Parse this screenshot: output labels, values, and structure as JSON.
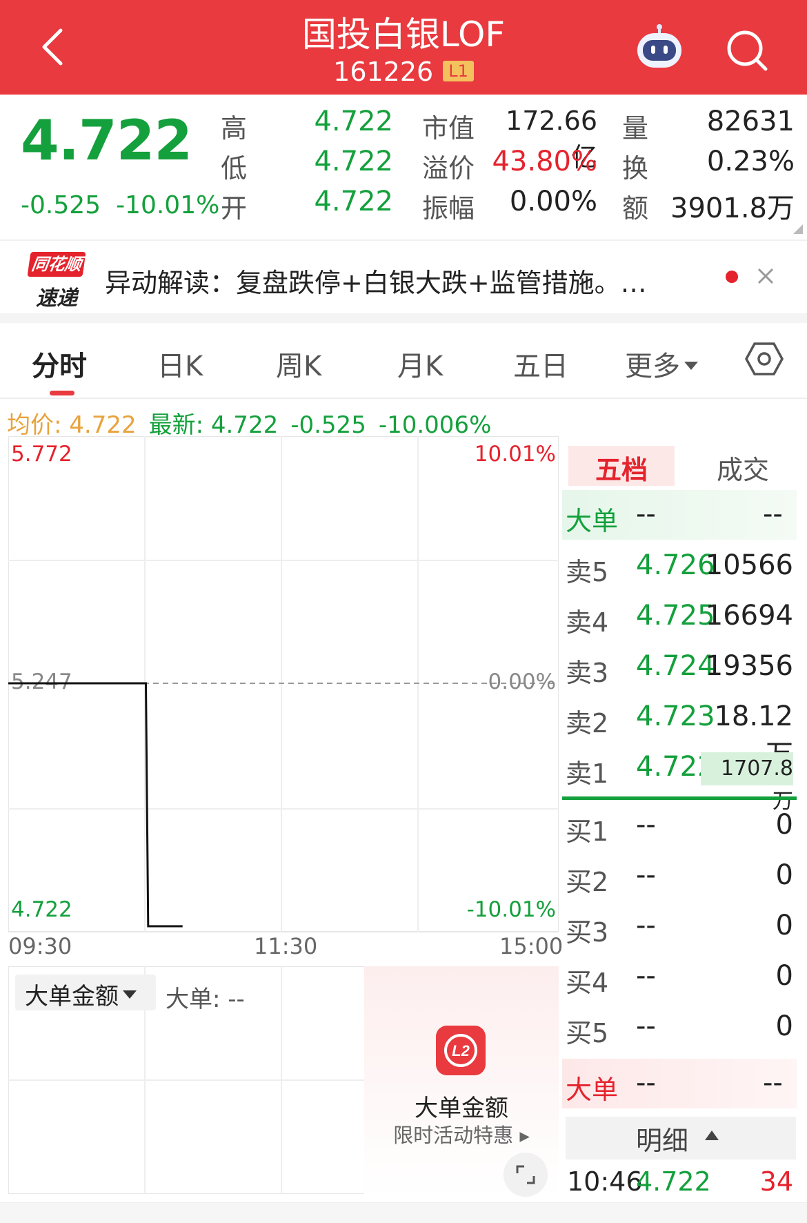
{
  "header": {
    "title": "国投白银LOF",
    "code": "161226",
    "level_badge": "L1"
  },
  "quote": {
    "price": "4.722",
    "change": "-0.525",
    "change_pct": "-10.01%",
    "fields": [
      {
        "label": "高",
        "value": "4.722"
      },
      {
        "label": "低",
        "value": "4.722"
      },
      {
        "label": "开",
        "value": "4.722"
      },
      {
        "label": "市值",
        "value": "172.66亿"
      },
      {
        "label": "溢价",
        "value": "43.80%"
      },
      {
        "label": "振幅",
        "value": "0.00%"
      },
      {
        "label": "量",
        "value": "82631"
      },
      {
        "label": "换",
        "value": "0.23%"
      },
      {
        "label": "额",
        "value": "3901.8万"
      }
    ]
  },
  "news": {
    "logo_top": "同花顺",
    "logo_bottom": "速递",
    "text": "异动解读：复盘跌停+白银大跌+监管措施。…"
  },
  "tabs": [
    {
      "label": "分时"
    },
    {
      "label": "日K"
    },
    {
      "label": "周K"
    },
    {
      "label": "月K"
    },
    {
      "label": "五日"
    },
    {
      "label": "更多"
    }
  ],
  "summary": {
    "avg_label": "均价: 4.722",
    "latest_label": "最新: 4.722",
    "change": "-0.525",
    "change_pct": "-10.006%"
  },
  "chart_data": {
    "type": "line",
    "ylim": [
      4.722,
      5.772
    ],
    "y_ticks_left": [
      "5.772",
      "5.247",
      "4.722"
    ],
    "y_ticks_right": [
      "10.01%",
      "0.00%",
      "-10.01%"
    ],
    "x_ticks": [
      "09:30",
      "11:30",
      "15:00"
    ],
    "prev_close": 5.247,
    "series": [
      {
        "values": [
          {
            "t": "09:30",
            "y": 5.247
          },
          {
            "t": "10:30",
            "y": 5.247
          },
          {
            "t": "10:31",
            "y": 4.722
          },
          {
            "t": "10:46",
            "y": 4.722
          }
        ]
      }
    ]
  },
  "volume_panel": {
    "select_label": "大单金额",
    "big_order_label": "大单: --"
  },
  "promo": {
    "icon_text": "L2",
    "title": "大单金额",
    "subtitle": "限时活动特惠"
  },
  "orderbook": {
    "tabs": [
      "五档",
      "成交"
    ],
    "top_big": {
      "label": "大单",
      "a": "--",
      "b": "--"
    },
    "asks": [
      {
        "label": "卖5",
        "price": "4.726",
        "vol": "10566"
      },
      {
        "label": "卖4",
        "price": "4.725",
        "vol": "16694"
      },
      {
        "label": "卖3",
        "price": "4.724",
        "vol": "19356"
      },
      {
        "label": "卖2",
        "price": "4.723",
        "vol": "18.12万"
      },
      {
        "label": "卖1",
        "price": "4.722",
        "vol": "1707.8万"
      }
    ],
    "bids": [
      {
        "label": "买1",
        "price": "--",
        "vol": "0"
      },
      {
        "label": "买2",
        "price": "--",
        "vol": "0"
      },
      {
        "label": "买3",
        "price": "--",
        "vol": "0"
      },
      {
        "label": "买4",
        "price": "--",
        "vol": "0"
      },
      {
        "label": "买5",
        "price": "--",
        "vol": "0"
      }
    ],
    "bottom_big": {
      "label": "大单",
      "a": "--",
      "b": "--"
    },
    "detail_label": "明细",
    "tick": {
      "time": "10:46",
      "price": "4.722",
      "vol": "34"
    }
  },
  "colors": {
    "header_red": "#e93a3f",
    "down_green": "#14a03c",
    "up_red": "#e4232d",
    "avg_orange": "#e8a33c"
  }
}
